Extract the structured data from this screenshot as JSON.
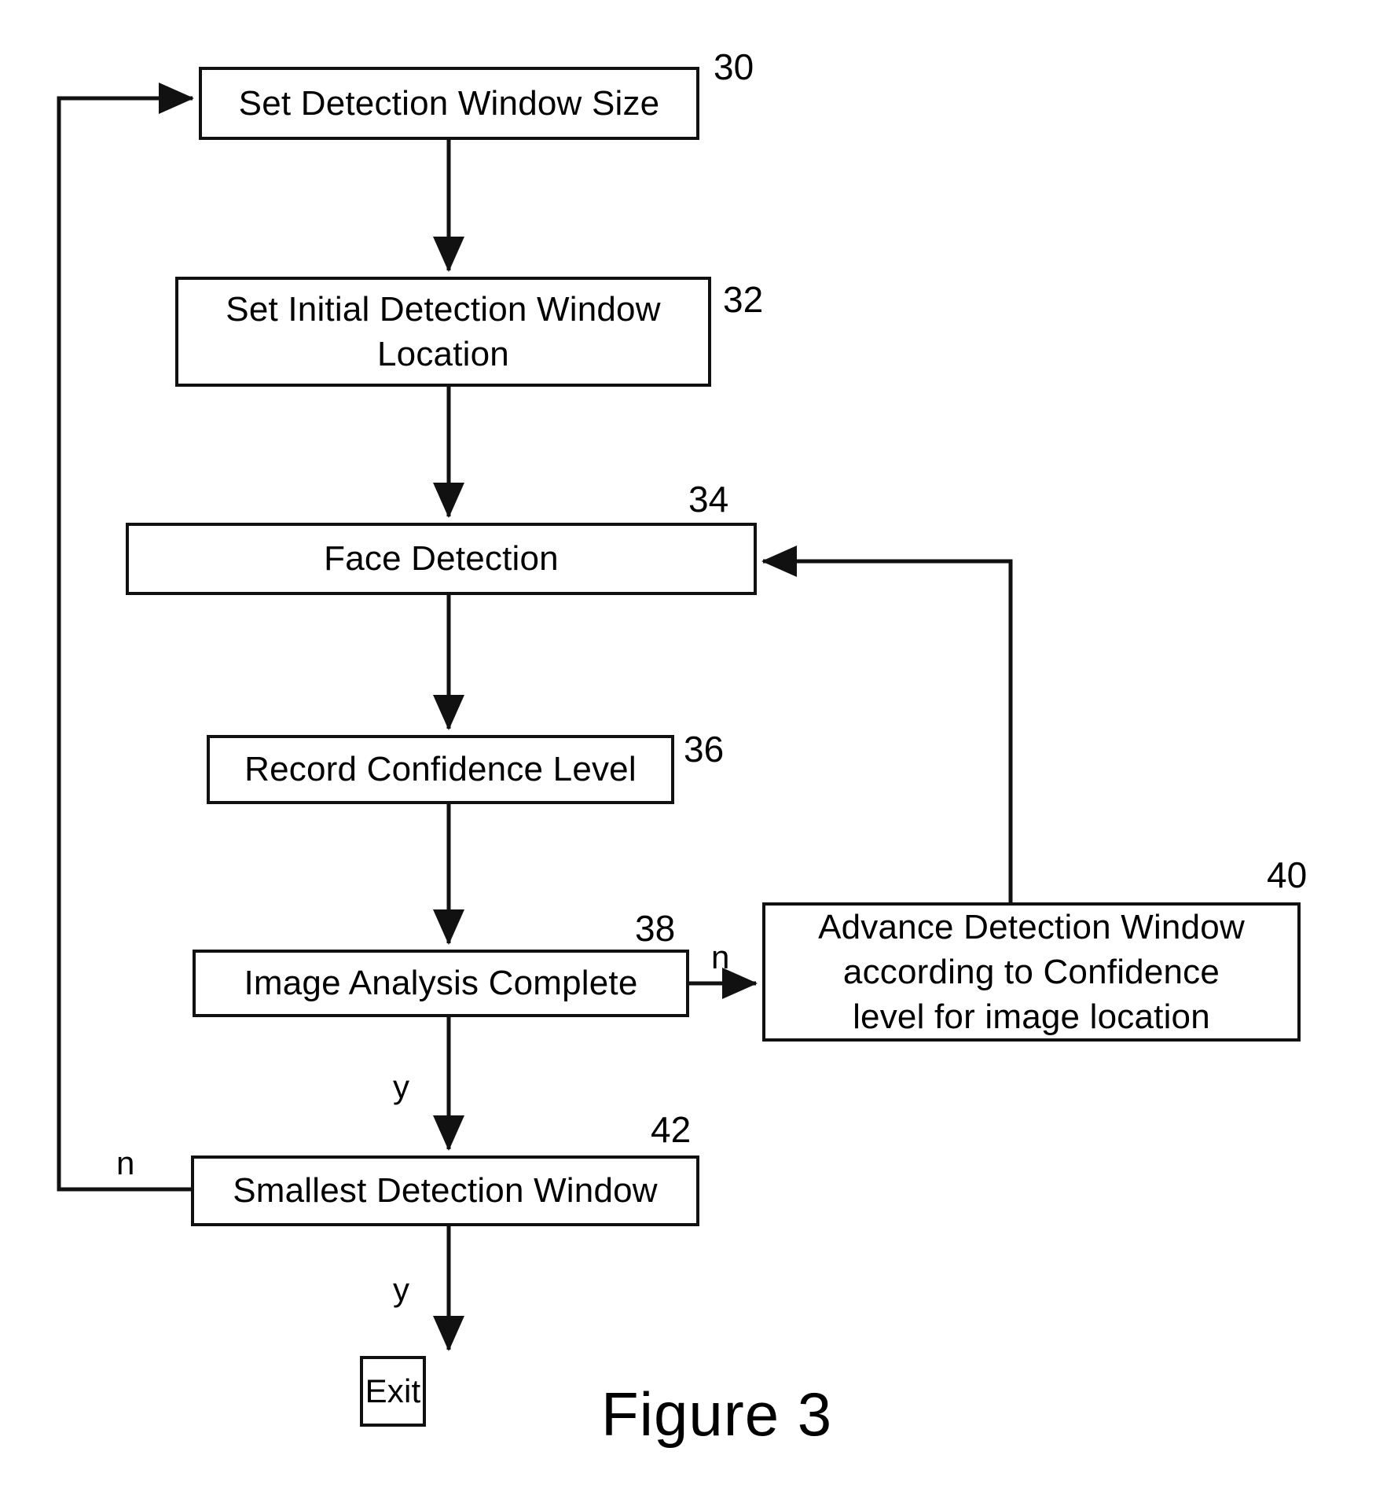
{
  "figure": {
    "caption": "Figure 3"
  },
  "nodes": [
    {
      "id": "30",
      "label": "Set Detection Window Size",
      "ref": "30"
    },
    {
      "id": "32",
      "label": "Set Initial Detection Window\nLocation",
      "ref": "32"
    },
    {
      "id": "34",
      "label": "Face Detection",
      "ref": "34"
    },
    {
      "id": "36",
      "label": "Record Confidence Level",
      "ref": "36"
    },
    {
      "id": "38",
      "label": "Image Analysis Complete",
      "ref": "38"
    },
    {
      "id": "40",
      "label": "Advance Detection Window\naccording to Confidence\nlevel for image location",
      "ref": "40"
    },
    {
      "id": "42",
      "label": "Smallest Detection Window",
      "ref": "42"
    },
    {
      "id": "exit",
      "label": "Exit",
      "ref": ""
    }
  ],
  "edge_labels": {
    "image_analysis_no": "n",
    "image_analysis_yes": "y",
    "smallest_window_no": "n",
    "smallest_window_yes": "y"
  },
  "colors": {
    "line": "#111111",
    "background": "#ffffff",
    "text": "#000000"
  }
}
